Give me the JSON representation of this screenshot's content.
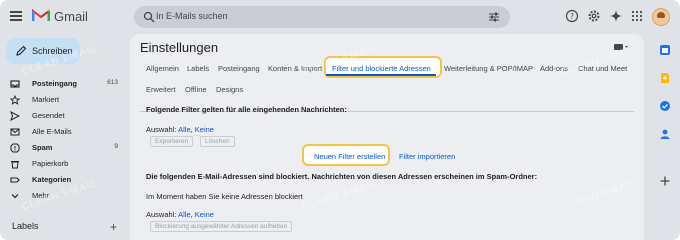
{
  "app": {
    "name": "Gmail"
  },
  "search": {
    "placeholder": "In E-Mails suchen"
  },
  "compose": {
    "label": "Schreiben"
  },
  "nav": [
    {
      "label": "Posteingang",
      "count": "613",
      "icon": "inbox-icon",
      "bold": true
    },
    {
      "label": "Markiert",
      "count": "",
      "icon": "star-icon",
      "bold": false
    },
    {
      "label": "Gesendet",
      "count": "",
      "icon": "send-icon",
      "bold": false
    },
    {
      "label": "Alle E-Mails",
      "count": "",
      "icon": "mail-icon",
      "bold": false
    },
    {
      "label": "Spam",
      "count": "9",
      "icon": "spam-icon",
      "bold": true
    },
    {
      "label": "Papierkorb",
      "count": "",
      "icon": "trash-icon",
      "bold": false
    },
    {
      "label": "Kategorien",
      "count": "",
      "icon": "label-icon",
      "bold": true
    },
    {
      "label": "Mehr",
      "count": "",
      "icon": "chevron-down-icon",
      "bold": false
    }
  ],
  "labels_section": {
    "title": "Labels",
    "add": "+"
  },
  "settings": {
    "title": "Einstellungen",
    "tabs_row1": [
      "Allgemein",
      "Labels",
      "Posteingang",
      "Konten & Import",
      "Filter und blockierte Adressen",
      "Weiterleitung & POP/IMAP",
      "Add-ons",
      "Chat und Meet"
    ],
    "tabs_row2": [
      "Erweitert",
      "Offline",
      "Designs"
    ],
    "filters_heading": "Folgende Filter gelten für alle eingehenden Nachrichten:",
    "select_prefix": "Auswahl:",
    "select_all": "Alle",
    "select_none": "Keine",
    "export_btn": "Exportieren",
    "delete_btn": "Löschen",
    "new_filter": "Neuen Filter erstellen",
    "import_filter": "Filter importieren",
    "blocked_heading": "Die folgenden E-Mail-Adressen sind blockiert. Nachrichten von diesen Adressen erscheinen im Spam-Ordner:",
    "no_blocked": "Im Moment haben Sie keine Adressen blockiert",
    "select_prefix2": "Auswahl:",
    "select_all2": "Alle",
    "select_none2": "Keine",
    "unblock_btn": "Blockierung ausgewählter Adressen aufheben"
  },
  "watermark": "CLEAN.EMAIL",
  "colors": {
    "accent": "#0b57d0",
    "highlight": "#f4c542",
    "compose_bg": "#c5dff5"
  }
}
